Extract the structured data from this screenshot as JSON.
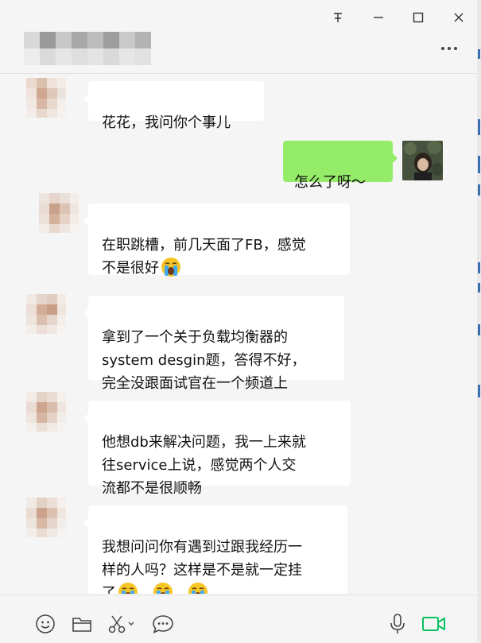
{
  "window": {
    "controls": {
      "pin_icon": "pin-icon",
      "minimize_icon": "minimize-icon",
      "maximize_icon": "maximize-icon",
      "close_icon": "close-icon"
    },
    "more_icon": "more-dots-icon"
  },
  "messages": [
    {
      "from": "other",
      "text": "花花，我问你个事儿",
      "emoji_count": 0
    },
    {
      "from": "me",
      "text": "怎么了呀～",
      "emoji_count": 0
    },
    {
      "from": "other",
      "text": "在职跳槽，前几天面了FB，感觉\n不是很好",
      "emoji_count": 1
    },
    {
      "from": "other",
      "text": "拿到了一个关于负载均衡器的\nsystem desgin题，答得不好，\n完全没跟面试官在一个频道上",
      "emoji_count": 0
    },
    {
      "from": "other",
      "text": "他想db来解决问题，我一上来就\n往service上说，感觉两个人交\n流都不是很顺畅",
      "emoji_count": 0
    },
    {
      "from": "other",
      "text": "我想问问你有遇到过跟我经历一\n样的人吗？这样是不是就一定挂\n了",
      "emoji_count": 3
    }
  ],
  "emoji": {
    "name": "loudly-crying-face-emoji"
  },
  "toolbar": {
    "icons": [
      "emoji-icon",
      "folder-icon",
      "scissors-icon",
      "chat-bubble-icon",
      "microphone-icon",
      "video-call-icon"
    ],
    "accent_green": "#07c160"
  },
  "colors": {
    "my_bubble": "#95ec69",
    "other_bubble": "#ffffff",
    "background": "#f5f5f5"
  }
}
